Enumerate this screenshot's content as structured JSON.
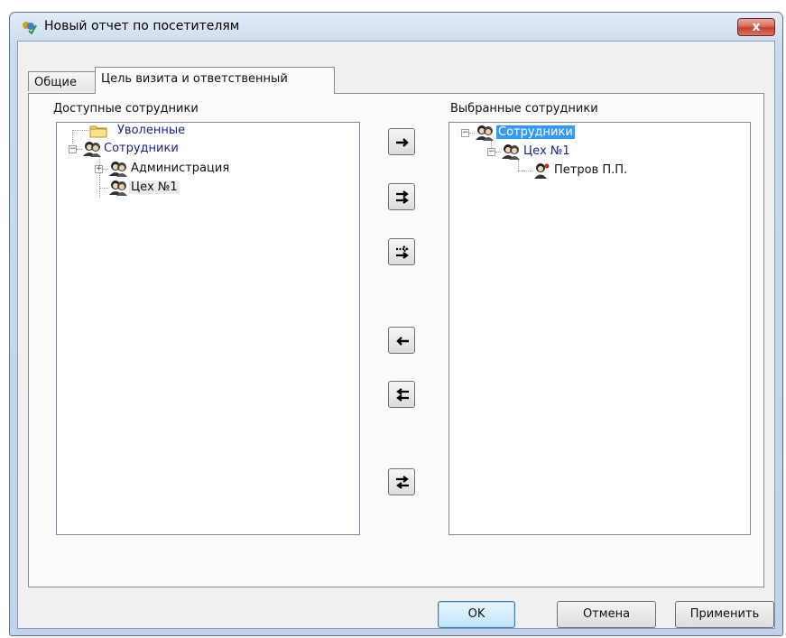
{
  "window": {
    "title": "Новый отчет по посетителям",
    "close_label": "x",
    "app_icon": "report-app-icon"
  },
  "tabs": [
    {
      "label": "Общие",
      "active": false
    },
    {
      "label": "Цель визита и ответственный",
      "active": true
    }
  ],
  "available": {
    "label": "Доступные сотрудники",
    "items": [
      {
        "label": "Уволенные",
        "icon": "folder-icon",
        "color": "#1b1f8f"
      },
      {
        "label": "Сотрудники",
        "icon": "group-icon",
        "color": "#1b1f8f",
        "expanded": true
      },
      {
        "label": "Администрация",
        "icon": "group-icon",
        "expanded": false
      },
      {
        "label": "Цех №1",
        "icon": "group-icon",
        "highlighted": true
      }
    ]
  },
  "selected": {
    "label": "Выбранные сотрудники",
    "items": [
      {
        "label": "Сотрудники",
        "icon": "group-icon",
        "expanded": true,
        "selected": true
      },
      {
        "label": "Цех №1",
        "icon": "group-icon",
        "expanded": true,
        "color": "#1b1f8f"
      },
      {
        "label": "Петров П.П.",
        "icon": "person-icon"
      }
    ]
  },
  "move_buttons": [
    "move-right",
    "move-all-right",
    "move-selected-right",
    "move-left",
    "move-all-left",
    "swap"
  ],
  "footer": {
    "ok": "OK",
    "cancel": "Отмена",
    "apply": "Применить"
  },
  "colors": {
    "accent": "#3399ff",
    "tree_text_blue": "#1b1f8f",
    "close_button": "#c4412c"
  }
}
